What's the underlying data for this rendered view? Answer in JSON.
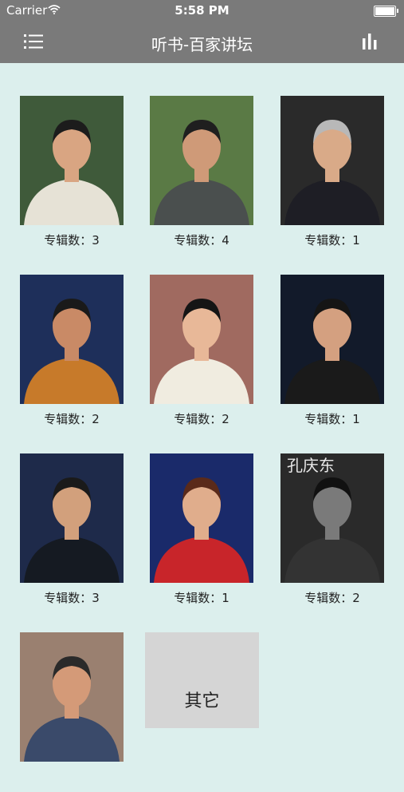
{
  "status_bar": {
    "carrier": "Carrier",
    "time": "5:58 PM"
  },
  "nav": {
    "title": "听书-百家讲坛"
  },
  "speakers": [
    {
      "label": "专辑数：3",
      "bg": "#3f5a3a",
      "skin": "#d9a582",
      "hair": "#1c1c1c",
      "cloth": "#e6e2d6"
    },
    {
      "label": "专辑数：4",
      "bg": "#5a7a45",
      "skin": "#cf9a78",
      "hair": "#1f1f1f",
      "cloth": "#4a4f4e"
    },
    {
      "label": "专辑数：1",
      "bg": "#2a2a2a",
      "skin": "#d9aa88",
      "hair": "#b8b8b8",
      "cloth": "#1e1e25"
    },
    {
      "label": "专辑数：2",
      "bg": "#1e2f5a",
      "skin": "#c98a66",
      "hair": "#1a1a1a",
      "cloth": "#c77a2a"
    },
    {
      "label": "专辑数：2",
      "bg": "#a06a60",
      "skin": "#e8b898",
      "hair": "#151515",
      "cloth": "#f0ece0"
    },
    {
      "label": "专辑数：1",
      "bg": "#121a2a",
      "skin": "#d4a080",
      "hair": "#151515",
      "cloth": "#1a1a1a"
    },
    {
      "label": "专辑数：3",
      "bg": "#1e2a4a",
      "skin": "#d2a07c",
      "hair": "#1a1a1a",
      "cloth": "#151a22"
    },
    {
      "label": "专辑数：1",
      "bg": "#1a2a6a",
      "skin": "#e0ad8c",
      "hair": "#5a2a1a",
      "cloth": "#c8252a"
    },
    {
      "label": "专辑数：2",
      "bg": "#2a2a2a",
      "skin": "#7a7a7a",
      "hair": "#111111",
      "cloth": "#333333",
      "poster_text": "孔庆东"
    },
    {
      "label": "",
      "bg": "#9a8070",
      "skin": "#d49a78",
      "hair": "#2a2a2a",
      "cloth": "#3a4a6a"
    }
  ],
  "other": {
    "label": "其它"
  }
}
